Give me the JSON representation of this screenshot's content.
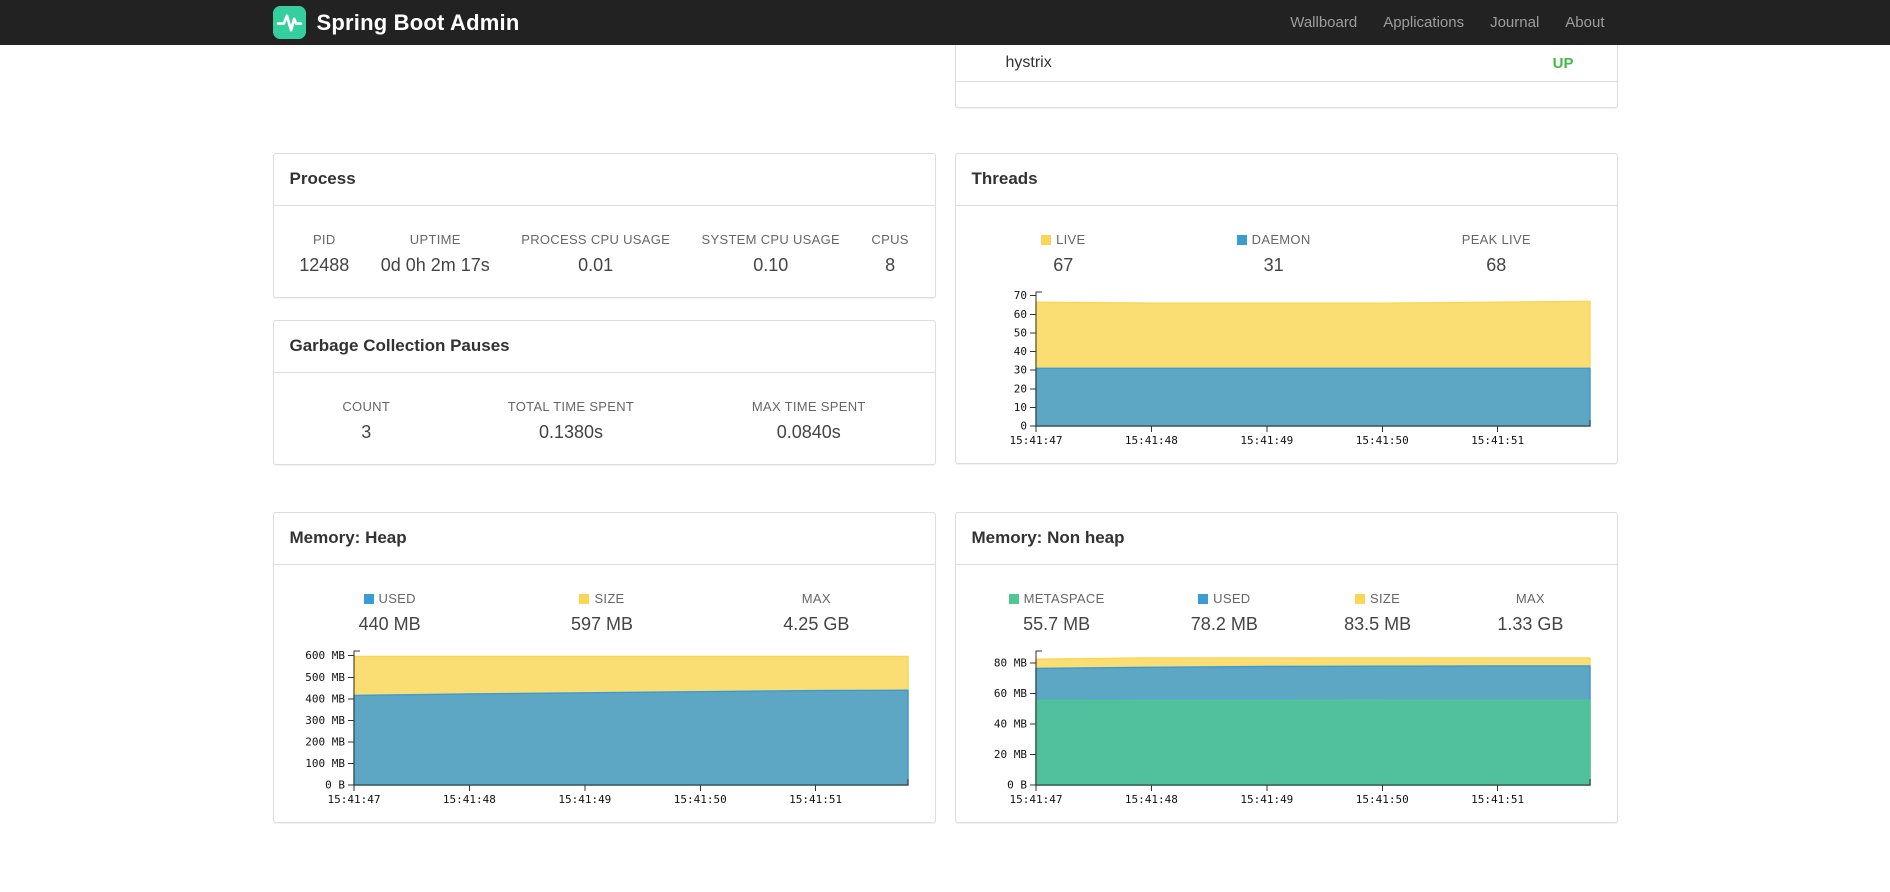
{
  "navbar": {
    "title": "Spring Boot Admin",
    "brand_color": "#35cf9e",
    "links": [
      {
        "label": "Wallboard"
      },
      {
        "label": "Applications"
      },
      {
        "label": "Journal"
      },
      {
        "label": "About"
      }
    ]
  },
  "health": {
    "service": "hystrix",
    "status": "UP",
    "status_color": "#3fbb46"
  },
  "colors": {
    "blue": "#3A9BD5",
    "yellow": "#F9D654",
    "green": "#4EC695"
  },
  "panels": {
    "process": {
      "title": "Process",
      "stats": [
        {
          "label": "PID",
          "value": "12488"
        },
        {
          "label": "UPTIME",
          "value": "0d 0h 2m 17s"
        },
        {
          "label": "PROCESS CPU USAGE",
          "value": "0.01"
        },
        {
          "label": "SYSTEM CPU USAGE",
          "value": "0.10"
        },
        {
          "label": "CPUS",
          "value": "8"
        }
      ]
    },
    "gc": {
      "title": "Garbage Collection Pauses",
      "stats": [
        {
          "label": "COUNT",
          "value": "3"
        },
        {
          "label": "TOTAL TIME SPENT",
          "value": "0.1380s"
        },
        {
          "label": "MAX TIME SPENT",
          "value": "0.0840s"
        }
      ]
    },
    "threads": {
      "title": "Threads",
      "stats": [
        {
          "label": "LIVE",
          "value": "67",
          "color": "#F9D654"
        },
        {
          "label": "DAEMON",
          "value": "31",
          "color": "#3A9BD5"
        },
        {
          "label": "PEAK LIVE",
          "value": "68"
        }
      ]
    },
    "heap": {
      "title": "Memory: Heap",
      "stats": [
        {
          "label": "USED",
          "value": "440 MB",
          "color": "#3A9BD5"
        },
        {
          "label": "SIZE",
          "value": "597 MB",
          "color": "#F9D654"
        },
        {
          "label": "MAX",
          "value": "4.25 GB"
        }
      ]
    },
    "nonheap": {
      "title": "Memory: Non heap",
      "stats": [
        {
          "label": "METASPACE",
          "value": "55.7 MB",
          "color": "#4EC695"
        },
        {
          "label": "USED",
          "value": "78.2 MB",
          "color": "#3A9BD5"
        },
        {
          "label": "SIZE",
          "value": "83.5 MB",
          "color": "#F9D654"
        },
        {
          "label": "MAX",
          "value": "1.33 GB"
        }
      ]
    }
  },
  "chart_data": [
    {
      "id": "threads",
      "type": "area",
      "title": "Threads",
      "note": "stacked area; series values are absolute totals, later series drawn on top",
      "x_ticks": [
        "15:41:47",
        "15:41:48",
        "15:41:49",
        "15:41:50",
        "15:41:51"
      ],
      "x_points": [
        0,
        1,
        2,
        3,
        4,
        4.8
      ],
      "ylim": [
        0,
        72
      ],
      "y_ticks": [
        {
          "v": 0,
          "label": "0"
        },
        {
          "v": 10,
          "label": "10"
        },
        {
          "v": 20,
          "label": "20"
        },
        {
          "v": 30,
          "label": "30"
        },
        {
          "v": 40,
          "label": "40"
        },
        {
          "v": 50,
          "label": "50"
        },
        {
          "v": 60,
          "label": "60"
        },
        {
          "v": 70,
          "label": "70"
        }
      ],
      "series": [
        {
          "name": "LIVE",
          "color": "#F9D654",
          "values": [
            66.5,
            66,
            66,
            66,
            66.5,
            67
          ]
        },
        {
          "name": "DAEMON",
          "color": "#3A9BD5",
          "values": [
            31,
            31,
            31,
            31,
            31,
            31
          ]
        }
      ]
    },
    {
      "id": "memory-heap",
      "type": "area",
      "title": "Memory: Heap",
      "note": "stacked area; series values are absolute totals in MB, later series drawn on top",
      "x_ticks": [
        "15:41:47",
        "15:41:48",
        "15:41:49",
        "15:41:50",
        "15:41:51"
      ],
      "x_points": [
        0,
        1,
        2,
        3,
        4,
        4.8
      ],
      "ylim": [
        0,
        622
      ],
      "y_ticks": [
        {
          "v": 0,
          "label": "0 B"
        },
        {
          "v": 100,
          "label": "100 MB"
        },
        {
          "v": 200,
          "label": "200 MB"
        },
        {
          "v": 300,
          "label": "300 MB"
        },
        {
          "v": 400,
          "label": "400 MB"
        },
        {
          "v": 500,
          "label": "500 MB"
        },
        {
          "v": 600,
          "label": "600 MB"
        }
      ],
      "series": [
        {
          "name": "SIZE",
          "color": "#F9D654",
          "values": [
            597,
            597,
            597,
            597,
            597,
            597
          ]
        },
        {
          "name": "USED",
          "color": "#3A9BD5",
          "values": [
            416,
            423,
            428,
            433,
            438,
            440
          ]
        }
      ]
    },
    {
      "id": "memory-nonheap",
      "type": "area",
      "title": "Memory: Non heap",
      "note": "stacked area; series values are absolute totals in MB, later series drawn on top",
      "x_ticks": [
        "15:41:47",
        "15:41:48",
        "15:41:49",
        "15:41:50",
        "15:41:51"
      ],
      "x_points": [
        0,
        1,
        2,
        3,
        4,
        4.8
      ],
      "ylim": [
        0,
        88
      ],
      "y_ticks": [
        {
          "v": 0,
          "label": "0 B"
        },
        {
          "v": 20,
          "label": "20 MB"
        },
        {
          "v": 40,
          "label": "40 MB"
        },
        {
          "v": 60,
          "label": "60 MB"
        },
        {
          "v": 80,
          "label": "80 MB"
        }
      ],
      "series": [
        {
          "name": "SIZE",
          "color": "#F9D654",
          "values": [
            82.6,
            83.5,
            83.5,
            83.5,
            83.5,
            83.5
          ]
        },
        {
          "name": "USED",
          "color": "#3A9BD5",
          "values": [
            76.6,
            77.3,
            77.8,
            78,
            78.2,
            78.2
          ]
        },
        {
          "name": "METASPACE",
          "color": "#4EC695",
          "values": [
            55.4,
            55.6,
            55.6,
            55.7,
            55.7,
            55.7
          ]
        }
      ]
    }
  ]
}
